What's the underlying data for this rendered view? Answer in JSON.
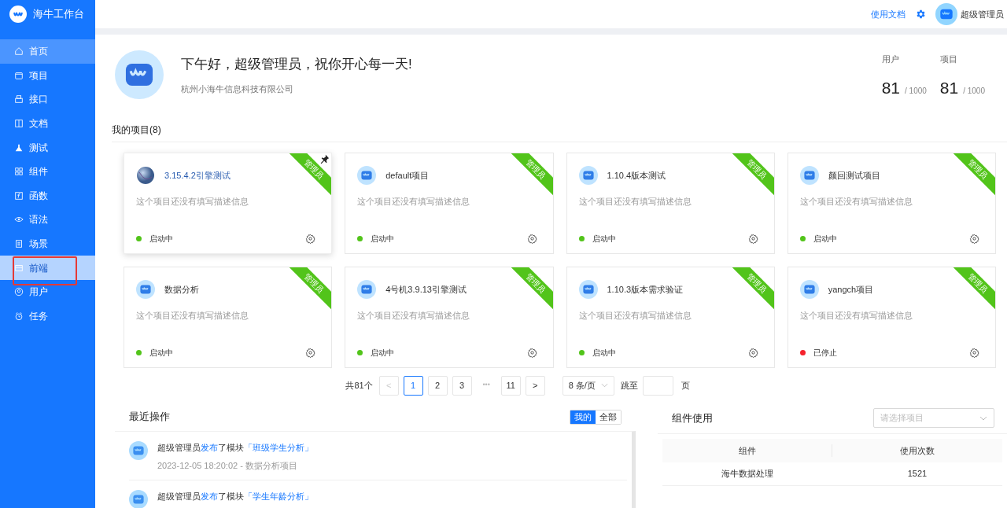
{
  "brand": {
    "title": "海牛工作台"
  },
  "sidebar": {
    "items": [
      {
        "label": "首页",
        "kind": "home",
        "selected": true,
        "hovered": false,
        "outlined": false
      },
      {
        "label": "项目",
        "kind": "folder",
        "selected": false,
        "hovered": false,
        "outlined": false
      },
      {
        "label": "接口",
        "kind": "printer",
        "selected": false,
        "hovered": false,
        "outlined": false
      },
      {
        "label": "文档",
        "kind": "book",
        "selected": false,
        "hovered": false,
        "outlined": false
      },
      {
        "label": "测试",
        "kind": "flask",
        "selected": false,
        "hovered": false,
        "outlined": false
      },
      {
        "label": "组件",
        "kind": "grid",
        "selected": false,
        "hovered": false,
        "outlined": false
      },
      {
        "label": "函数",
        "kind": "fx",
        "selected": false,
        "hovered": false,
        "outlined": false
      },
      {
        "label": "语法",
        "kind": "eye",
        "selected": false,
        "hovered": false,
        "outlined": false
      },
      {
        "label": "场景",
        "kind": "doc",
        "selected": false,
        "hovered": false,
        "outlined": false
      },
      {
        "label": "前端",
        "kind": "screen",
        "selected": false,
        "hovered": true,
        "outlined": true
      },
      {
        "label": "用户",
        "kind": "user",
        "selected": false,
        "hovered": false,
        "outlined": false
      },
      {
        "label": "任务",
        "kind": "clock",
        "selected": false,
        "hovered": false,
        "outlined": false
      }
    ]
  },
  "header": {
    "docs_link": "使用文档",
    "user_name": "超级管理员"
  },
  "welcome": {
    "greeting": "下午好，超级管理员，祝你开心每一天!",
    "company": "杭州小海牛信息科技有限公司",
    "stats": [
      {
        "label": "用户",
        "value": "81",
        "limit": "/ 1000"
      },
      {
        "label": "项目",
        "value": "81",
        "limit": "/ 1000"
      }
    ]
  },
  "projects": {
    "title": "我的项目(8)",
    "items": [
      {
        "name": "3.15.4.2引擎测试",
        "kind": "globe",
        "ribbon": "管理员",
        "pinned": true,
        "hovered": true,
        "description": "这个项目还没有填写描述信息",
        "status": "启动中",
        "color": "#52c41a"
      },
      {
        "name": "default项目",
        "kind": "logo",
        "ribbon": "管理员",
        "pinned": false,
        "hovered": false,
        "description": "这个项目还没有填写描述信息",
        "status": "启动中",
        "color": "#52c41a"
      },
      {
        "name": "1.10.4版本测试",
        "kind": "logo",
        "ribbon": "管理员",
        "pinned": false,
        "hovered": false,
        "description": "这个项目还没有填写描述信息",
        "status": "启动中",
        "color": "#52c41a"
      },
      {
        "name": "颜回测试项目",
        "kind": "logo",
        "ribbon": "管理员",
        "pinned": false,
        "hovered": false,
        "description": "这个项目还没有填写描述信息",
        "status": "启动中",
        "color": "#52c41a"
      },
      {
        "name": "数据分析",
        "kind": "logo",
        "ribbon": "管理员",
        "pinned": false,
        "hovered": false,
        "description": "这个项目还没有填写描述信息",
        "status": "启动中",
        "color": "#52c41a"
      },
      {
        "name": "4号机3.9.13引擎测试",
        "kind": "logo",
        "ribbon": "管理员",
        "pinned": false,
        "hovered": false,
        "description": "这个项目还没有填写描述信息",
        "status": "启动中",
        "color": "#52c41a"
      },
      {
        "name": "1.10.3版本需求验证",
        "kind": "logo",
        "ribbon": "管理员",
        "pinned": false,
        "hovered": false,
        "description": "这个项目还没有填写描述信息",
        "status": "启动中",
        "color": "#52c41a"
      },
      {
        "name": "yangch项目",
        "kind": "logo",
        "ribbon": "管理员",
        "pinned": false,
        "hovered": false,
        "description": "这个项目还没有填写描述信息",
        "status": "已停止",
        "color": "#f5222d"
      }
    ]
  },
  "pagination": {
    "total": "共81个",
    "prev": "<",
    "next": ">",
    "ellipsis": "•••",
    "pages": [
      {
        "label": "1",
        "selected": true
      },
      {
        "label": "2",
        "selected": false
      },
      {
        "label": "3",
        "selected": false
      },
      {
        "label": "11",
        "selected": false
      }
    ],
    "page_size": "8 条/页",
    "jump_label": "跳至",
    "page_unit": "页"
  },
  "recent": {
    "title": "最近操作",
    "tabs": [
      {
        "label": "我的",
        "selected": true
      },
      {
        "label": "全部",
        "selected": false
      }
    ],
    "items": [
      {
        "user": "超级管理员",
        "action": "发布",
        "object_type": "了模块",
        "target": "「班级学生分析」",
        "meta": "2023-12-05 18:20:02 - 数据分析项目"
      },
      {
        "user": "超级管理员",
        "action": "发布",
        "object_type": "了模块",
        "target": "「学生年龄分析」"
      }
    ]
  },
  "components": {
    "title": "组件使用",
    "select": {
      "placeholder": "请选择项目"
    },
    "table": {
      "columns": [
        "组件",
        "使用次数"
      ],
      "rows": [
        [
          "海牛数据处理",
          "1521"
        ]
      ]
    }
  }
}
